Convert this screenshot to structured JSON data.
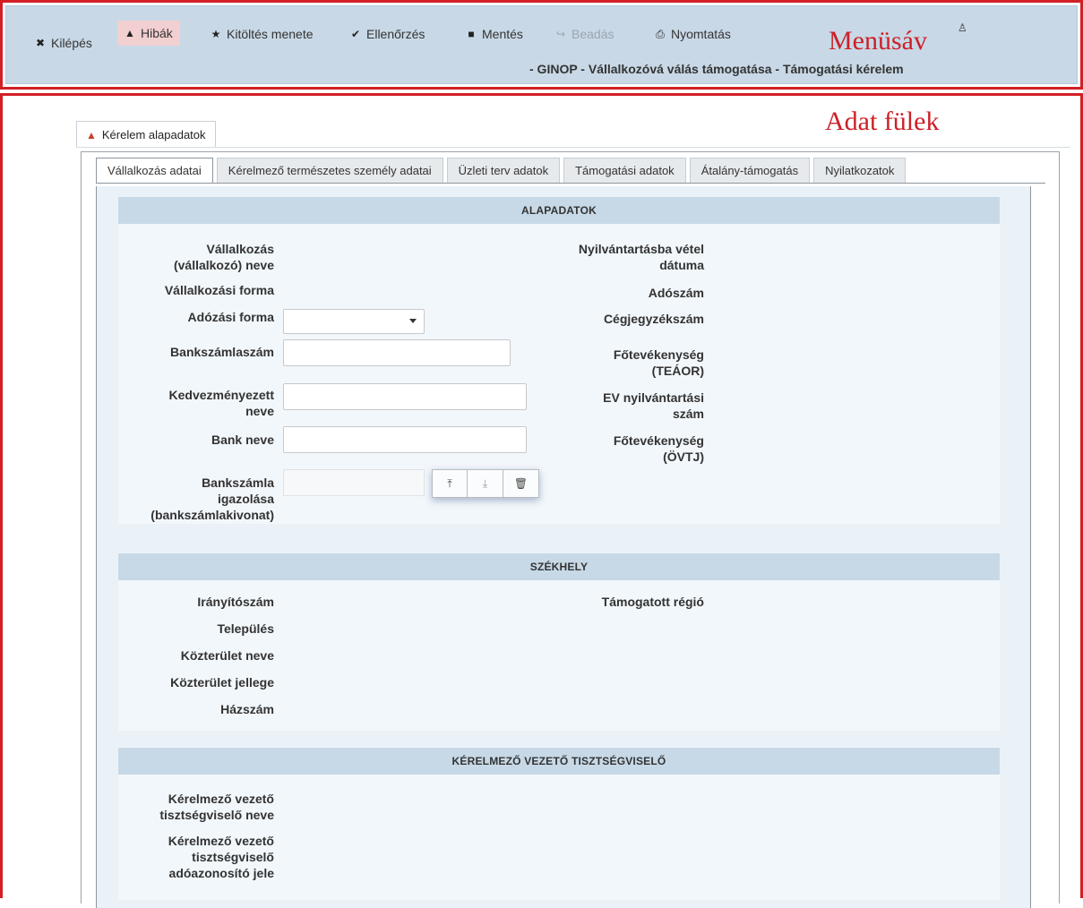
{
  "menubar": {
    "items": [
      {
        "label": "Kilépés",
        "icon": "close-icon",
        "glyph": "✖"
      },
      {
        "label": "Hibák",
        "icon": "warning-icon",
        "glyph": "▲"
      },
      {
        "label": "Kitöltés menete",
        "icon": "star-icon",
        "glyph": "★"
      },
      {
        "label": "Ellenőrzés",
        "icon": "checkmark-icon",
        "glyph": "✔"
      },
      {
        "label": "Mentés",
        "icon": "save-icon",
        "glyph": "■"
      },
      {
        "label": "Beadás",
        "icon": "share-icon",
        "glyph": "↪",
        "disabled": true
      },
      {
        "label": "Nyomtatás",
        "icon": "print-icon",
        "glyph": "⎙"
      }
    ],
    "user_glyph": "♙",
    "annotation": "Menüsáv",
    "breadcrumb": "- GINOP - Vállalkozóvá válás támogatása - Támogatási kérelem"
  },
  "data_tabs": {
    "annotation": "Adat fülek",
    "top_tab": "Kérelem alapadatok",
    "sub_tabs": [
      "Vállalkozás adatai",
      "Kérelmező természetes személy adatai",
      "Üzleti terv adatok",
      "Támogatási adatok",
      "Átalány-támogatás",
      "Nyilatkozatok"
    ],
    "active_sub_tab": "Vállalkozás adatai"
  },
  "sections": {
    "alapadatok": {
      "title": "ALAPADATOK",
      "left": {
        "company_name": "Vállalkozás\n(vállalkozó) neve",
        "company_form": "Vállalkozási forma",
        "tax_form": "Adózási forma",
        "bank_account": "Bankszámlaszám",
        "beneficiary": "Kedvezményezett\nneve",
        "bank_name": "Bank neve",
        "bank_proof": "Bankszámla\nigazolása\n(bankszámlakivonat)"
      },
      "right": {
        "registration_date": "Nyilvántartásba vétel\ndátuma",
        "tax_number": "Adószám",
        "company_reg_number": "Cégjegyzékszám",
        "main_activity_teaor": "Főtevékenység\n(TEÁOR)",
        "ev_reg_number": "EV nyilvántartási\nszám",
        "main_activity_ovtj": "Főtevékenység\n(ÖVTJ)"
      },
      "fields": {
        "tax_form_value": "",
        "bank_account_value": "",
        "beneficiary_value": "",
        "bank_name_value": ""
      },
      "file_buttons": {
        "upload": "⤒",
        "download": "⤓",
        "delete": "🗑"
      }
    },
    "szekhely": {
      "title": "SZÉKHELY",
      "left": {
        "zip": "Irányítószám",
        "city": "Település",
        "street": "Közterület neve",
        "street_type": "Közterület jellege",
        "house_number": "Házszám"
      },
      "right": {
        "region": "Támogatott régió"
      }
    },
    "vezeto": {
      "title": "KÉRELMEZŐ VEZETŐ TISZTSÉGVISELŐ",
      "left": {
        "name": "Kérelmező vezető\ntisztségviselő neve",
        "tax_id": "Kérelmező vezető\ntisztségviselő\nadóazonosító jele"
      }
    }
  }
}
